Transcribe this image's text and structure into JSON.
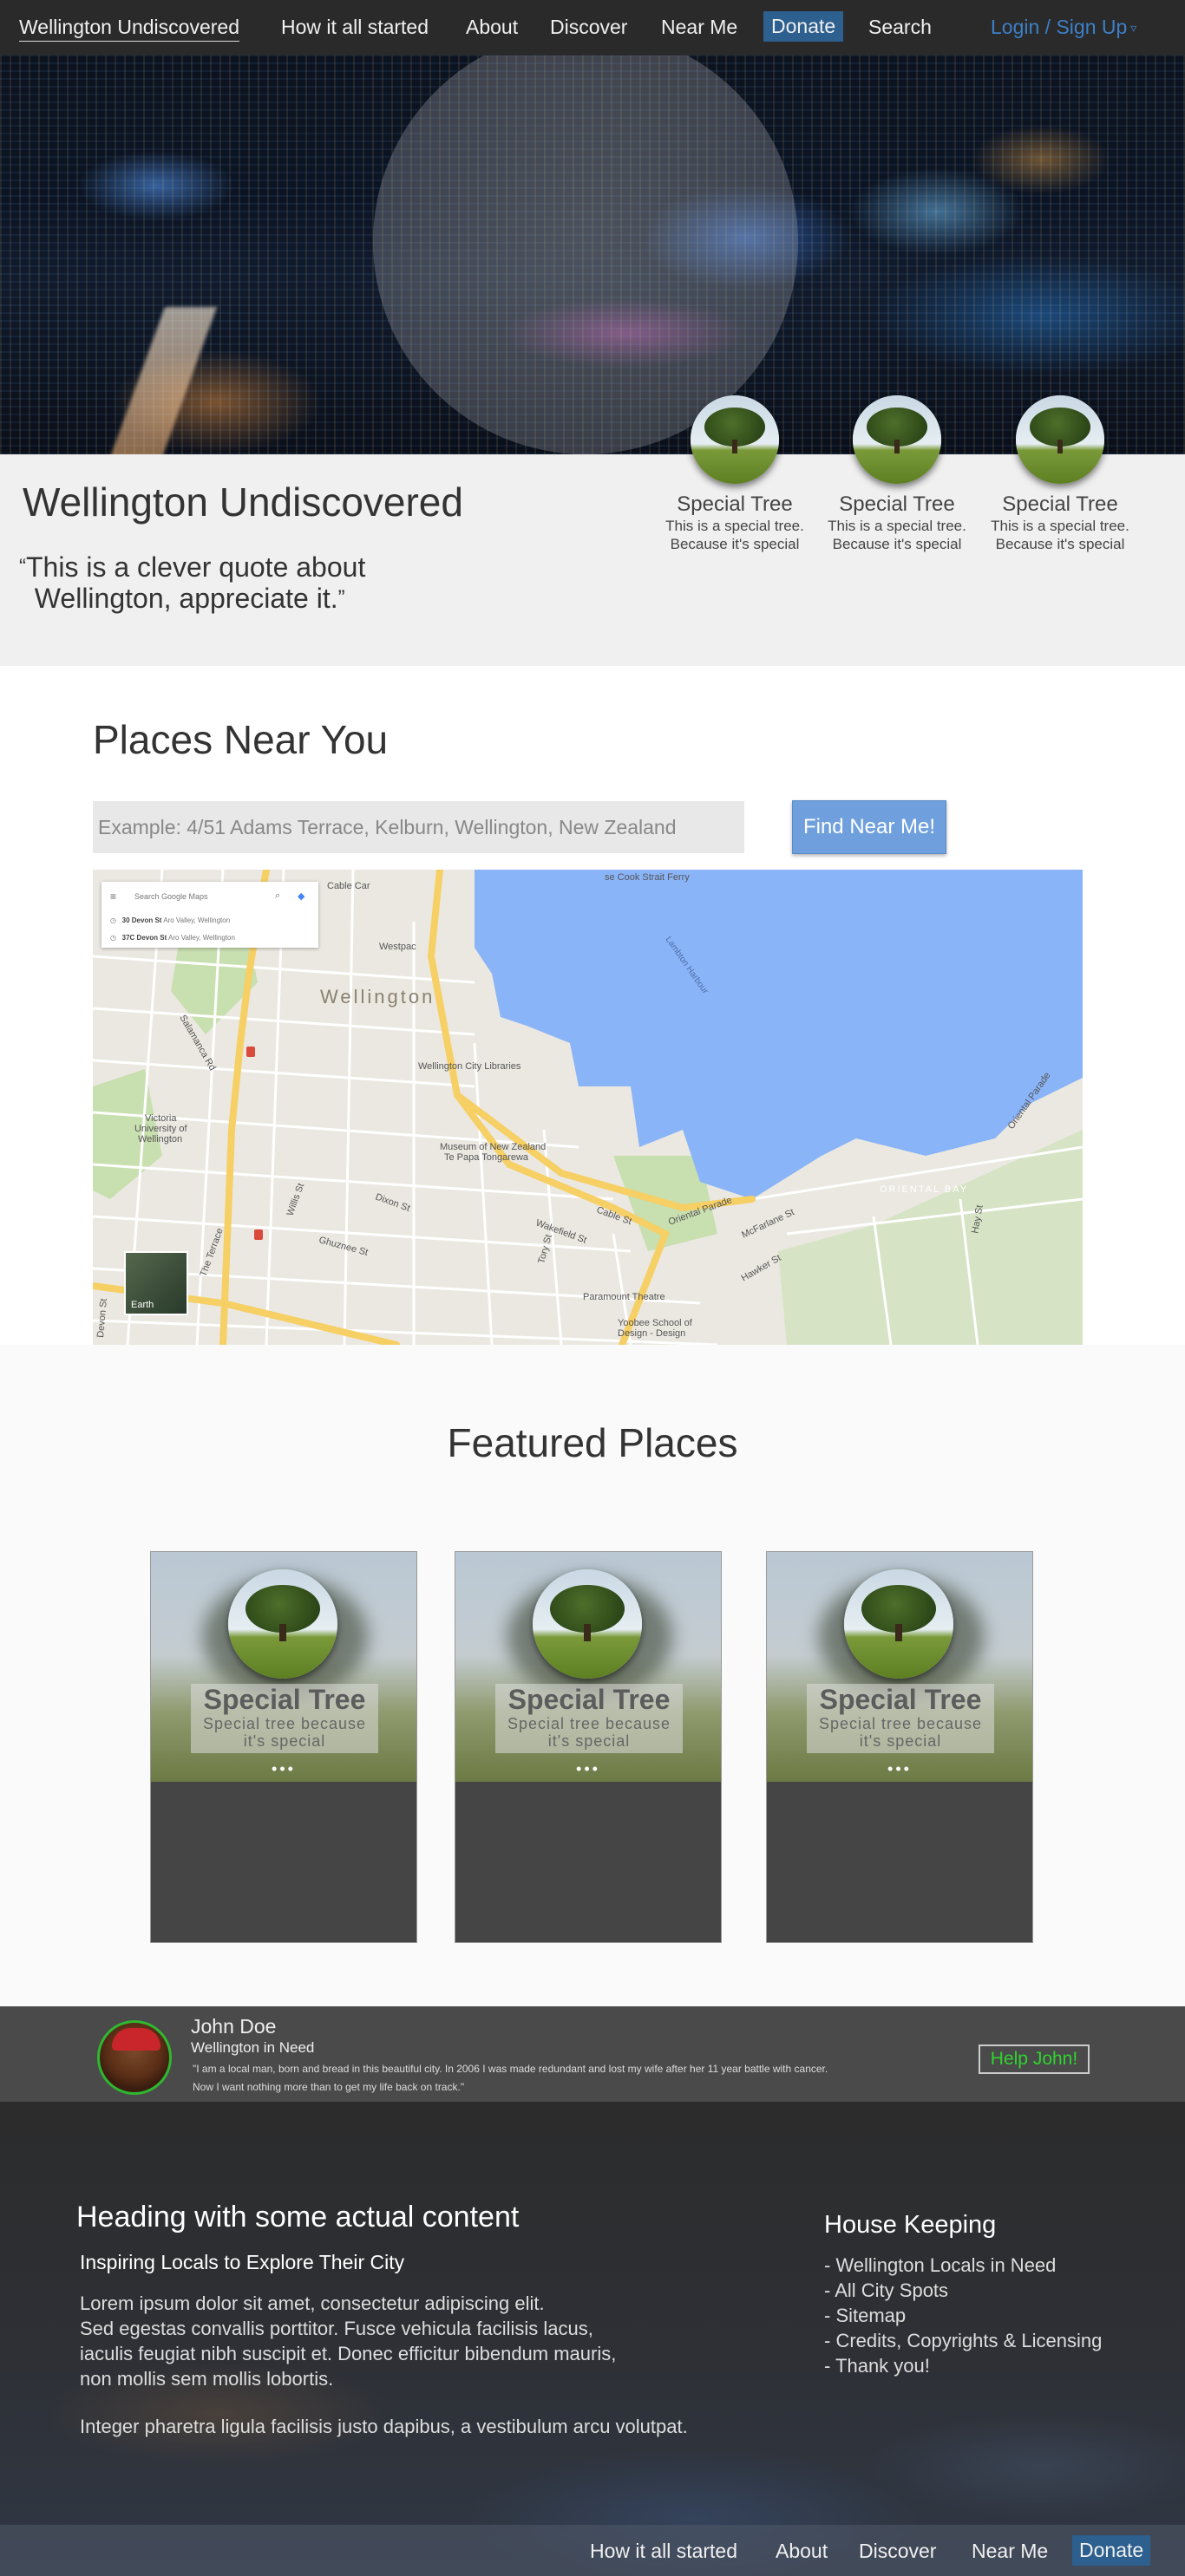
{
  "nav": {
    "brand": "Wellington Undiscovered",
    "links": [
      "How it all started",
      "About",
      "Discover",
      "Near Me"
    ],
    "donate": "Donate",
    "search": "Search",
    "login": "Login / Sign Up",
    "login_icon": "chevron-down-icon"
  },
  "intro": {
    "title": "Wellington Undiscovered",
    "quote_open": "“",
    "quote_line1": "This is a clever quote about",
    "quote_line2": "Wellington, appreciate it.",
    "quote_close": "”",
    "specials": [
      {
        "title": "Special Tree",
        "desc1": "This is a special tree.",
        "desc2": "Because it's special"
      },
      {
        "title": "Special Tree",
        "desc1": "This is a special tree.",
        "desc2": "Because it's special"
      },
      {
        "title": "Special Tree",
        "desc1": "This is a special tree.",
        "desc2": "Because it's special"
      }
    ]
  },
  "places": {
    "title": "Places Near You",
    "placeholder": "Example: 4/51 Adams Terrace, Kelburn, Wellington, New Zealand",
    "button": "Find Near Me!"
  },
  "map": {
    "search_placeholder": "Search Google Maps",
    "suggestion1": "30 Devon St",
    "suggestion1_sub": "Aro Valley, Wellington",
    "suggestion2": "37C Devon St",
    "suggestion2_sub": "Aro Valley, Wellington",
    "labels": {
      "city": "Wellington",
      "ferry": "se Cook Strait Ferry",
      "harbour": "Lambton Harbour",
      "cablecar": "Cable Car",
      "westpac": "Westpac",
      "library": "Wellington City Libraries",
      "salamanca": "Salamanca Rd",
      "victoria1": "Victoria",
      "victoria2": "University of",
      "victoria3": "Wellington",
      "museum1": "Museum of New Zealand",
      "museum2": "Te Papa Tongarewa",
      "dixon": "Dixon St",
      "willis": "Willis St",
      "terrace": "The Terrace",
      "ghuznee": "Ghuznee St",
      "cable": "Cable St",
      "wakefield": "Wakefield St",
      "tory": "Tory St",
      "oriental": "Oriental Parade",
      "mcfarlane": "McFarlane St",
      "hawker": "Hawker St",
      "orientalbay": "ORIENTAL BAY",
      "oriental2": "Oriental Parade",
      "paramount": "Paramount Theatre",
      "yoobee1": "Yoobee School of",
      "yoobee2": "Design - Design",
      "devon": "Devon St",
      "hay": "Hay St"
    },
    "earth_label": "Earth",
    "colors": {
      "water": "#8ab4f8",
      "land": "#ebe8e1",
      "park": "#c8dfb0",
      "major_road": "#f6cf65"
    }
  },
  "featured": {
    "title": "Featured Places",
    "cards": [
      {
        "title": "Special Tree",
        "desc1": "Special tree because",
        "desc2": "it's special",
        "dots": "•••"
      },
      {
        "title": "Special Tree",
        "desc1": "Special tree because",
        "desc2": "it's special",
        "dots": "•••"
      },
      {
        "title": "Special Tree",
        "desc1": "Special tree because",
        "desc2": "it's special",
        "dots": "•••"
      }
    ]
  },
  "person": {
    "name": "John Doe",
    "subtitle": "Wellington in Need",
    "story1": "\"I am a local man, born and bread in this beautiful city. In 2006 I was made redundant and lost my wife after her 11 year battle with cancer.",
    "story2": "Now I want nothing more than to get my life back on track.\"",
    "button": "Help John!",
    "accent": "#2fb82f"
  },
  "footer": {
    "heading": "Heading with some actual content",
    "subheading": "Inspiring Locals to Explore Their City",
    "para1_l1": "Lorem ipsum dolor sit amet, consectetur adipiscing elit.",
    "para1_l2": "Sed egestas convallis porttitor. Fusce vehicula facilisis lacus,",
    "para1_l3": "iaculis feugiat nibh suscipit et. Donec efficitur bibendum mauris,",
    "para1_l4": "non mollis sem mollis lobortis.",
    "para2": "Integer pharetra ligula facilisis justo dapibus, a vestibulum arcu volutpat.",
    "housekeeping_title": "House Keeping",
    "housekeeping": [
      "- Wellington Locals in Need",
      "- All City Spots",
      "- Sitemap",
      "- Credits, Copyrights & Licensing",
      "- Thank you!"
    ]
  },
  "bottom_nav": {
    "links": [
      "How it all started",
      "About",
      "Discover",
      "Near Me"
    ],
    "donate": "Donate"
  }
}
